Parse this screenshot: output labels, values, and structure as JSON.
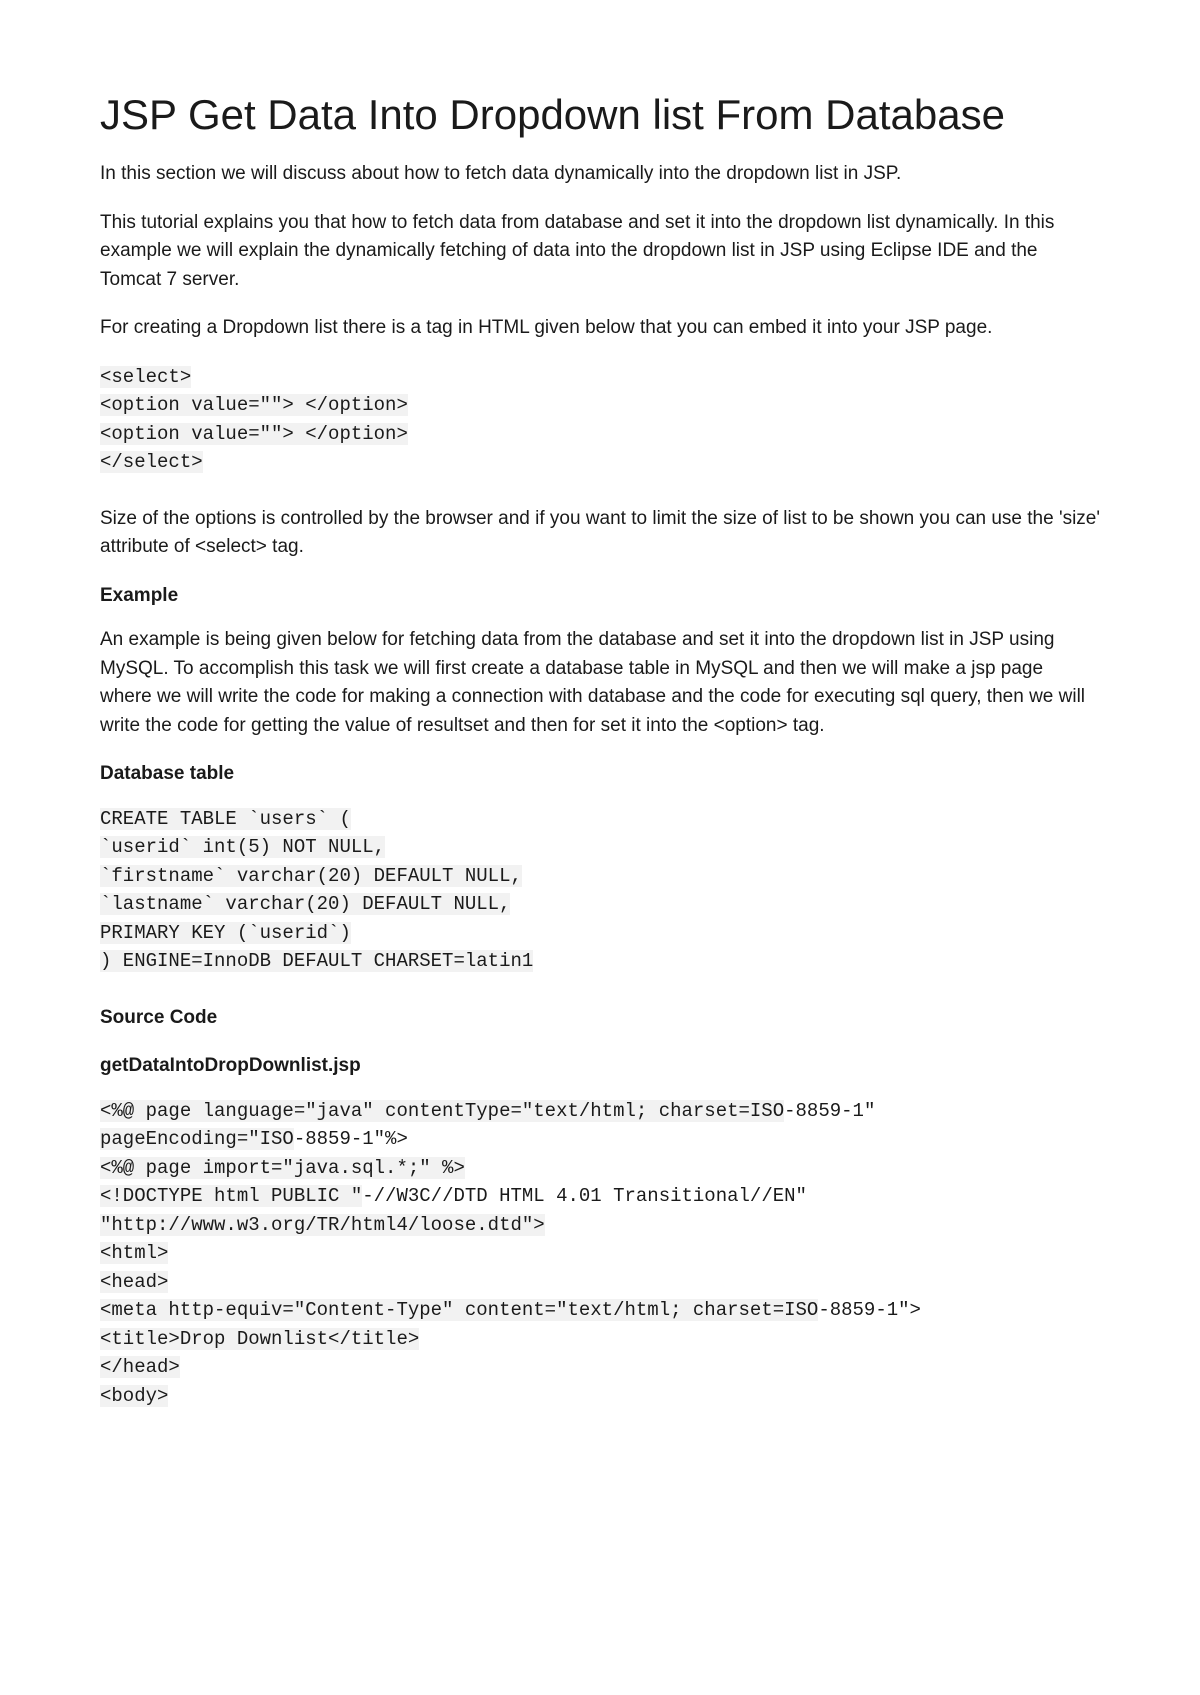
{
  "title": "JSP Get Data Into Dropdown list From Database",
  "intro": "In this section we will discuss about how to fetch data dynamically into the dropdown list in JSP.",
  "para2": "This tutorial explains you that how to fetch data from database and set it into the dropdown list dynamically. In this example we will explain the dynamically fetching of data into the dropdown list in JSP using Eclipse IDE and the Tomcat 7 server.",
  "para3": "For creating a Dropdown list there is a tag in HTML given below that you can embed it into your JSP page.",
  "codeblock1": {
    "l1": "<select>",
    "l2": "<option value=\"\"> </option>",
    "l3": "<option value=\"\"> </option>",
    "l4": "</select>"
  },
  "para4": "Size of the options is controlled by the browser and if you want to limit the size of list to be shown you can use the 'size' attribute of <select> tag.",
  "heading_example": "Example",
  "para5": "An example is being given below for fetching data from the database and set it into the dropdown list in JSP using MySQL. To accomplish this task we will first create a database table in MySQL and then we will make a jsp page where we will write the code for making a connection with database and the code for executing sql query, then we will write the code for getting the value of resultset and then for set it into the <option> tag.",
  "heading_db": "Database table",
  "db_code": "CREATE TABLE `users` (\n`userid` int(5) NOT NULL,\n`firstname` varchar(20) DEFAULT NULL,\n`lastname` varchar(20) DEFAULT NULL,\nPRIMARY KEY (`userid`)\n) ENGINE=InnoDB DEFAULT CHARSET=latin1",
  "heading_src": "Source Code",
  "heading_file": "getDataIntoDropDownlist.jsp",
  "jsp_code": {
    "l1a": "<%@ page language=\"java\" contentType=\"text/html; charset=ISO",
    "l1b": "-8859-1\"",
    "l2a": "pageEncoding=\"ISO",
    "l2b": "-8859-1\"%>",
    "l3": "<%@ page import=\"java.sql.*;\" %>",
    "l4a": "<!DOCTYPE html PUBLIC \"",
    "l4b": "-//W3C//DTD HTML 4.01 Transitional//EN\"",
    "l5": "\"http://www.w3.org/TR/html4/loose.dtd\">",
    "l6": "<html>",
    "l7": "<head>",
    "l8a": "<meta http-equiv=\"Content-Type\" content=\"text/html; charset=ISO",
    "l8b": "-8859-1\">",
    "l9": "<title>Drop Downlist</title>",
    "l10": "</head>",
    "l11": "<body>"
  }
}
